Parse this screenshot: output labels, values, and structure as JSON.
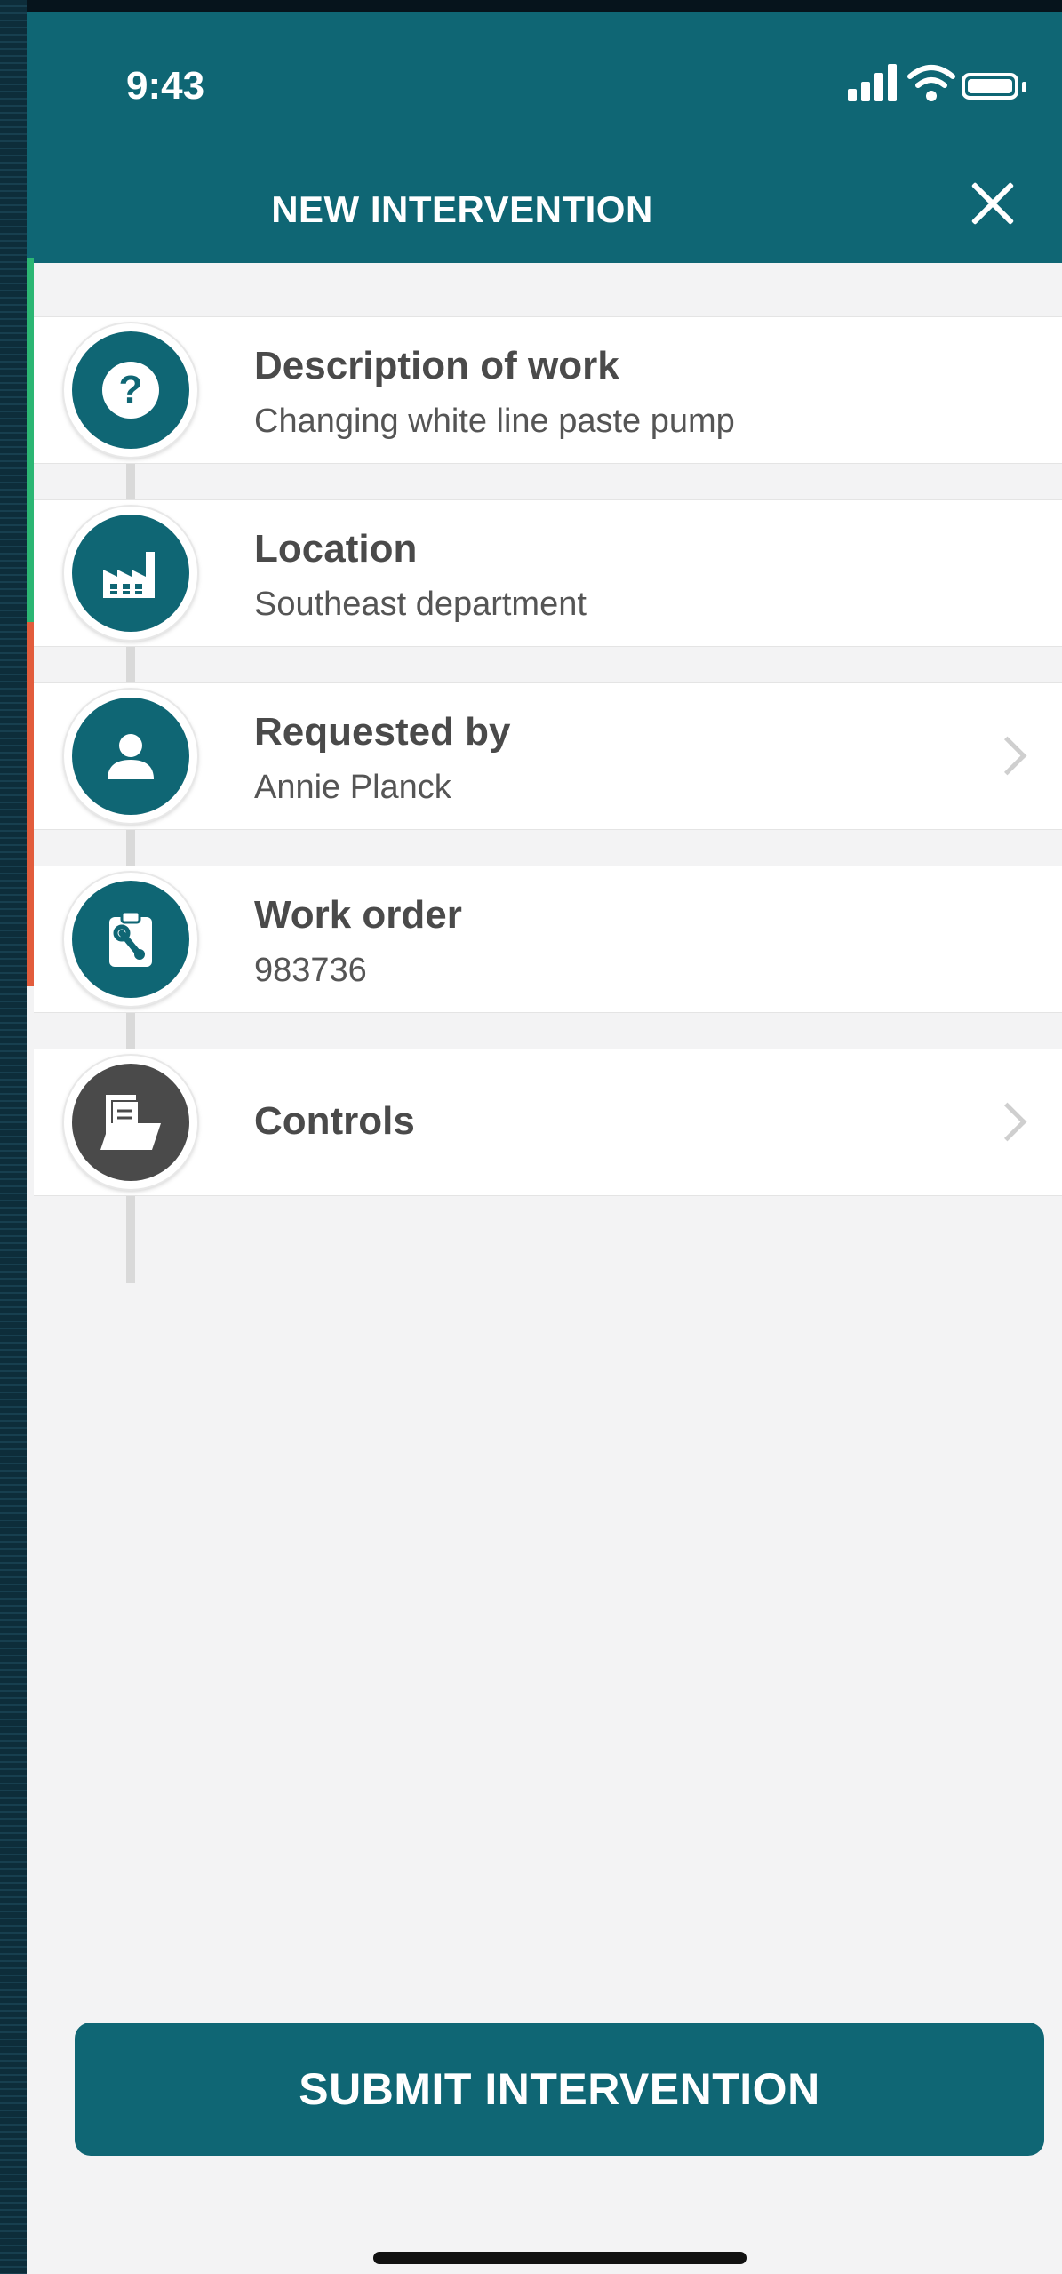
{
  "status_bar": {
    "time": "9:43"
  },
  "header": {
    "title": "NEW INTERVENTION"
  },
  "items": [
    {
      "title": "Description of work",
      "subtitle": "Changing white line paste pump",
      "icon": "question-icon"
    },
    {
      "title": "Location",
      "subtitle": "Southeast department",
      "icon": "factory-icon"
    },
    {
      "title": "Requested by",
      "subtitle": "Annie Planck",
      "icon": "person-icon"
    },
    {
      "title": "Work order",
      "subtitle": "983736",
      "icon": "work-order-clipboard-icon"
    },
    {
      "title": "Controls",
      "subtitle": "",
      "icon": "documents-folder-icon"
    }
  ],
  "submit_label": "SUBMIT INTERVENTION",
  "colors": {
    "primary": "#0f6674",
    "accent_green": "#2bb673",
    "accent_red": "#e25c3c",
    "controls_icon": "#4a4a4a"
  }
}
